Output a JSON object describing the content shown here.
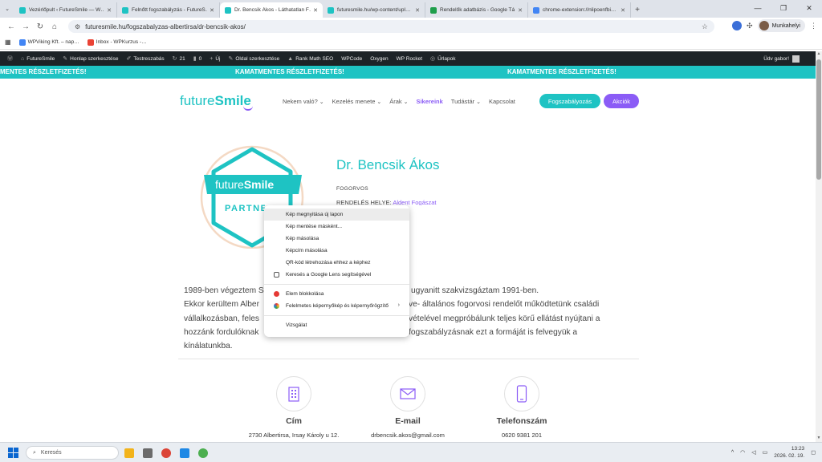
{
  "browser": {
    "tabs": [
      {
        "label": "Vezérlőpult ‹ FutureSmile — W…",
        "color": "#1ec3c3",
        "active": false
      },
      {
        "label": "Felnőtt fogszabályzás - FutureS…",
        "color": "#1ec3c3",
        "active": false
      },
      {
        "label": "Dr. Bencsik Ákos - Láthatatlan F…",
        "color": "#1ec3c3",
        "active": true
      },
      {
        "label": "futuresmile.hu/wp-content/upl…",
        "color": "#1ec3c3",
        "active": false
      },
      {
        "label": "Rendelők adatbázis - Google Tá…",
        "color": "#1e9e4b",
        "active": false
      },
      {
        "label": "chrome-extension://nlipoenfbi…",
        "color": "#4285f4",
        "active": false
      }
    ],
    "url": "futuresmile.hu/fogszabalyzas-albertirsa/dr-bencsik-akos/",
    "profile_name": "Munkahelyi",
    "bookmarks": [
      {
        "label": "WPViking Kft. – nap…",
        "color": "#4285f4"
      },
      {
        "label": "Inbox - WPKurzus -…",
        "color": "#ea4335"
      }
    ]
  },
  "adminbar": {
    "items": [
      {
        "icon": "wordpress-icon",
        "glyph": "Ⓦ",
        "label": ""
      },
      {
        "icon": "home-icon",
        "glyph": "⌂",
        "label": "FutureSmile"
      },
      {
        "icon": "edit-icon",
        "glyph": "✎",
        "label": "Honlap szerkesztése"
      },
      {
        "icon": "brush-icon",
        "glyph": "✐",
        "label": "Testreszabás"
      },
      {
        "icon": "updates-icon",
        "glyph": "↻",
        "label": "21"
      },
      {
        "icon": "comments-icon",
        "glyph": "▮",
        "label": "0"
      },
      {
        "icon": "plus-icon",
        "glyph": "+",
        "label": "Új"
      },
      {
        "icon": "page-edit-icon",
        "glyph": "✎",
        "label": "Oldal szerkesztése"
      },
      {
        "icon": "rankmath-icon",
        "glyph": "▲",
        "label": "Rank Math SEO"
      },
      {
        "icon": "",
        "glyph": "",
        "label": "WPCode"
      },
      {
        "icon": "",
        "glyph": "",
        "label": "Oxygen"
      },
      {
        "icon": "",
        "glyph": "",
        "label": "WP Rocket"
      },
      {
        "icon": "forms-icon",
        "glyph": "◎",
        "label": "Űrlapok"
      }
    ],
    "greeting": "Üdv gabor!"
  },
  "promo": {
    "text": "KAMATMENTES RÉSZLETFIZETÉS!",
    "text_cut": "MENTES RÉSZLETFIZETÉS!"
  },
  "site": {
    "logo_light": "future",
    "logo_bold": "Smile",
    "menu": [
      {
        "label": "Nekem való?",
        "dropdown": true,
        "active": false
      },
      {
        "label": "Kezelés menete",
        "dropdown": true,
        "active": false
      },
      {
        "label": "Árak",
        "dropdown": true,
        "active": false
      },
      {
        "label": "Sikereink",
        "dropdown": false,
        "active": true
      },
      {
        "label": "Tudástár",
        "dropdown": true,
        "active": false
      },
      {
        "label": "Kapcsolat",
        "dropdown": false,
        "active": false
      }
    ],
    "cta_primary": "Fogszabályozás",
    "cta_secondary": "Akciók"
  },
  "badge": {
    "logo_light": "future",
    "logo_bold": "Smile",
    "ribbon": "PARTNER"
  },
  "doctor": {
    "name": "Dr. Bencsik Ákos",
    "role": "FOGORVOS",
    "place_label": "RENDELÉS HELYE:",
    "place_value": "Aldent Fogászat",
    "bio_lines": [
      "1989-ben végeztem Semmelweis Egyetem Fogorvostudományi Karán, ugyanitt szakvizsgáztam 1991-ben.",
      "Ekkor kerültem Albertirsára és feleségemmel egy modern, jól felszerelt, ambuláns fogpótló és felnőtt- valamint gyermek-, serdülő és fiatal felnőtt- általános fogorvosi rendelőt működtetünk családi",
      "vállalkozásban, feleségem mint gyermekfogorvos, én pedig mint fogpótlás és fogszabályozás szakorvos, együtt csapatunk tagjainak segítségével megpróbálunk teljes körű ellátást nyújtani a",
      "hozzánk fordulóknak. A Future Smile láthatatlan fogszabályzási módszerét is alkalmazzuk, mivel nagyon sok pácienst érdekel a láthatatlan fogszabályzásnak ezt a formáját is felvegyük a",
      "kínálatunkba."
    ],
    "bio_visible": [
      {
        "l": "1989-ben végeztem S",
        "r": "ugyanitt szakvizsgáztam 1991-ben."
      },
      {
        "l": "Ekkor kerültem Alber",
        "r": "ve- általános fogorvosi rendelőt működtetünk családi"
      },
      {
        "l": "vállalkozásban, feles",
        "r": "vételével megpróbálunk teljes körű ellátást nyújtani a"
      },
      {
        "l": "hozzánk fordulóknak",
        "r": "fogszabályzásnak ezt a formáját is felvegyük a"
      },
      {
        "l": "kínálatunkba.",
        "r": ""
      }
    ]
  },
  "contact": [
    {
      "title": "Cím",
      "value": "2730 Albertirsa, Irsay Károly u 12.",
      "icon": "building-icon"
    },
    {
      "title": "E-mail",
      "value": "drbencsik.akos@gmail.com",
      "icon": "envelope-icon"
    },
    {
      "title": "Telefonszám",
      "value": "0620 9381 201",
      "icon": "phone-icon"
    }
  ],
  "context_menu": {
    "items": [
      {
        "label": "Kép megnyitása új lapon",
        "hover": true
      },
      {
        "label": "Kép mentése másként..."
      },
      {
        "label": "Kép másolása"
      },
      {
        "label": "Képcím másolása"
      },
      {
        "label": "QR-kód létrehozása ehhez a képhez"
      },
      {
        "label": "Keresés a Google Lens segítségével",
        "icon": "google-lens-icon"
      },
      {
        "sep": true
      },
      {
        "label": "Elem blokkolása",
        "icon": "adblock-icon"
      },
      {
        "label": "Felelmetes képernyőkép és képernyőrögzítő",
        "icon": "screenshot-ext-icon",
        "submenu": true
      },
      {
        "sep": true
      },
      {
        "label": "Vizsgálat"
      }
    ]
  },
  "taskbar": {
    "search_placeholder": "Keresés",
    "time": "13:23",
    "date": "2026. 02. 19.",
    "apps": [
      {
        "name": "file-explorer-icon",
        "color": "#f2b31b"
      },
      {
        "name": "store-icon",
        "color": "#6b6b6b"
      },
      {
        "name": "chrome-icon",
        "color": "#db4437"
      },
      {
        "name": "notepad-icon",
        "color": "#1e88e5"
      },
      {
        "name": "chrome-alt-icon",
        "color": "#4caf50"
      }
    ]
  }
}
